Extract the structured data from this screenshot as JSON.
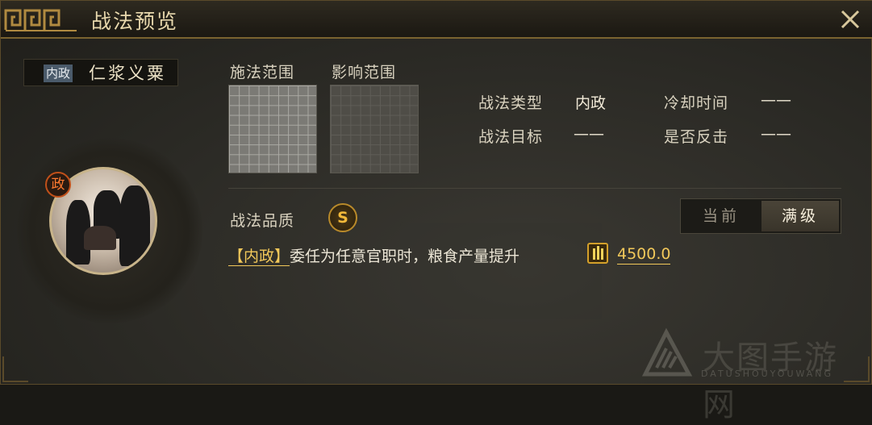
{
  "window": {
    "title": "战法预览",
    "close_icon": "close-icon"
  },
  "skill": {
    "tag": "内政",
    "name": "仁浆义粟",
    "portrait_badge": "政"
  },
  "range": {
    "cast_label": "施法范围",
    "effect_label": "影响范围"
  },
  "info": {
    "type_label": "战法类型",
    "type_value": "内政",
    "target_label": "战法目标",
    "target_value": "——",
    "cooldown_label": "冷却时间",
    "cooldown_value": "——",
    "counter_label": "是否反击",
    "counter_value": "——"
  },
  "quality": {
    "label": "战法品质",
    "grade": "S"
  },
  "level_toggle": {
    "current": "当前",
    "max": "满级",
    "selected": "max"
  },
  "description": {
    "keyword": "【内政】",
    "text": "委任为任意官职时，粮食产量提升",
    "amount": "4500.0",
    "icon": "grain-icon"
  },
  "watermark": {
    "text": "大图手游网",
    "sub": "DATUSHOUYOUWANG"
  },
  "colors": {
    "gold": "#f2c85a",
    "accent_border": "#7a6330",
    "tag_bg": "#4a5a6a"
  }
}
